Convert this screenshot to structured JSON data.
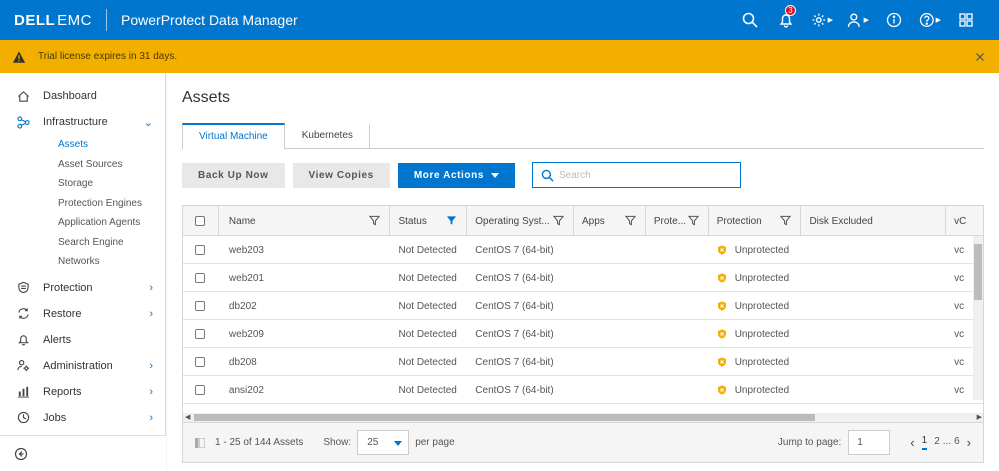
{
  "header": {
    "logo_dell": "DELL",
    "logo_emc": "EMC",
    "app_title": "PowerProtect Data Manager",
    "alert_count": "3"
  },
  "banner": {
    "text": "Trial license expires in 31 days."
  },
  "sidebar": {
    "items": [
      {
        "label": "Dashboard"
      },
      {
        "label": "Infrastructure"
      },
      {
        "label": "Protection"
      },
      {
        "label": "Restore"
      },
      {
        "label": "Alerts"
      },
      {
        "label": "Administration"
      },
      {
        "label": "Reports"
      },
      {
        "label": "Jobs"
      }
    ],
    "infrastructure_sub": [
      {
        "label": "Assets"
      },
      {
        "label": "Asset Sources"
      },
      {
        "label": "Storage"
      },
      {
        "label": "Protection Engines"
      },
      {
        "label": "Application Agents"
      },
      {
        "label": "Search Engine"
      },
      {
        "label": "Networks"
      }
    ]
  },
  "main": {
    "title": "Assets",
    "tabs": [
      {
        "label": "Virtual Machine"
      },
      {
        "label": "Kubernetes"
      }
    ],
    "toolbar": {
      "backup_label": "Back Up Now",
      "view_copies_label": "View Copies",
      "more_actions_label": "More Actions",
      "search_placeholder": "Search"
    },
    "table": {
      "columns": [
        "Name",
        "Status",
        "Operating Syst...",
        "Apps",
        "Prote...",
        "Protection",
        "Disk Excluded",
        "vC"
      ],
      "rows": [
        {
          "name": "web203",
          "status": "Not Detected",
          "os": "CentOS 7 (64-bit)",
          "protection": "Unprotected",
          "vc": "vc"
        },
        {
          "name": "web201",
          "status": "Not Detected",
          "os": "CentOS 7 (64-bit)",
          "protection": "Unprotected",
          "vc": "vc"
        },
        {
          "name": "db202",
          "status": "Not Detected",
          "os": "CentOS 7 (64-bit)",
          "protection": "Unprotected",
          "vc": "vc"
        },
        {
          "name": "web209",
          "status": "Not Detected",
          "os": "CentOS 7 (64-bit)",
          "protection": "Unprotected",
          "vc": "vc"
        },
        {
          "name": "db208",
          "status": "Not Detected",
          "os": "CentOS 7 (64-bit)",
          "protection": "Unprotected",
          "vc": "vc"
        },
        {
          "name": "ansi202",
          "status": "Not Detected",
          "os": "CentOS 7 (64-bit)",
          "protection": "Unprotected",
          "vc": "vc"
        }
      ]
    },
    "footer": {
      "count_text": "1 - 25 of 144 Assets",
      "show_label": "Show:",
      "per_page_value": "25",
      "per_page_label": "per page",
      "jump_label": "Jump to page:",
      "jump_value": "1",
      "pages": [
        "1",
        "2",
        "...",
        "6"
      ]
    }
  },
  "colors": {
    "brand": "#0076ce",
    "banner": "#f2af00",
    "unprotected": "#f2af00"
  }
}
